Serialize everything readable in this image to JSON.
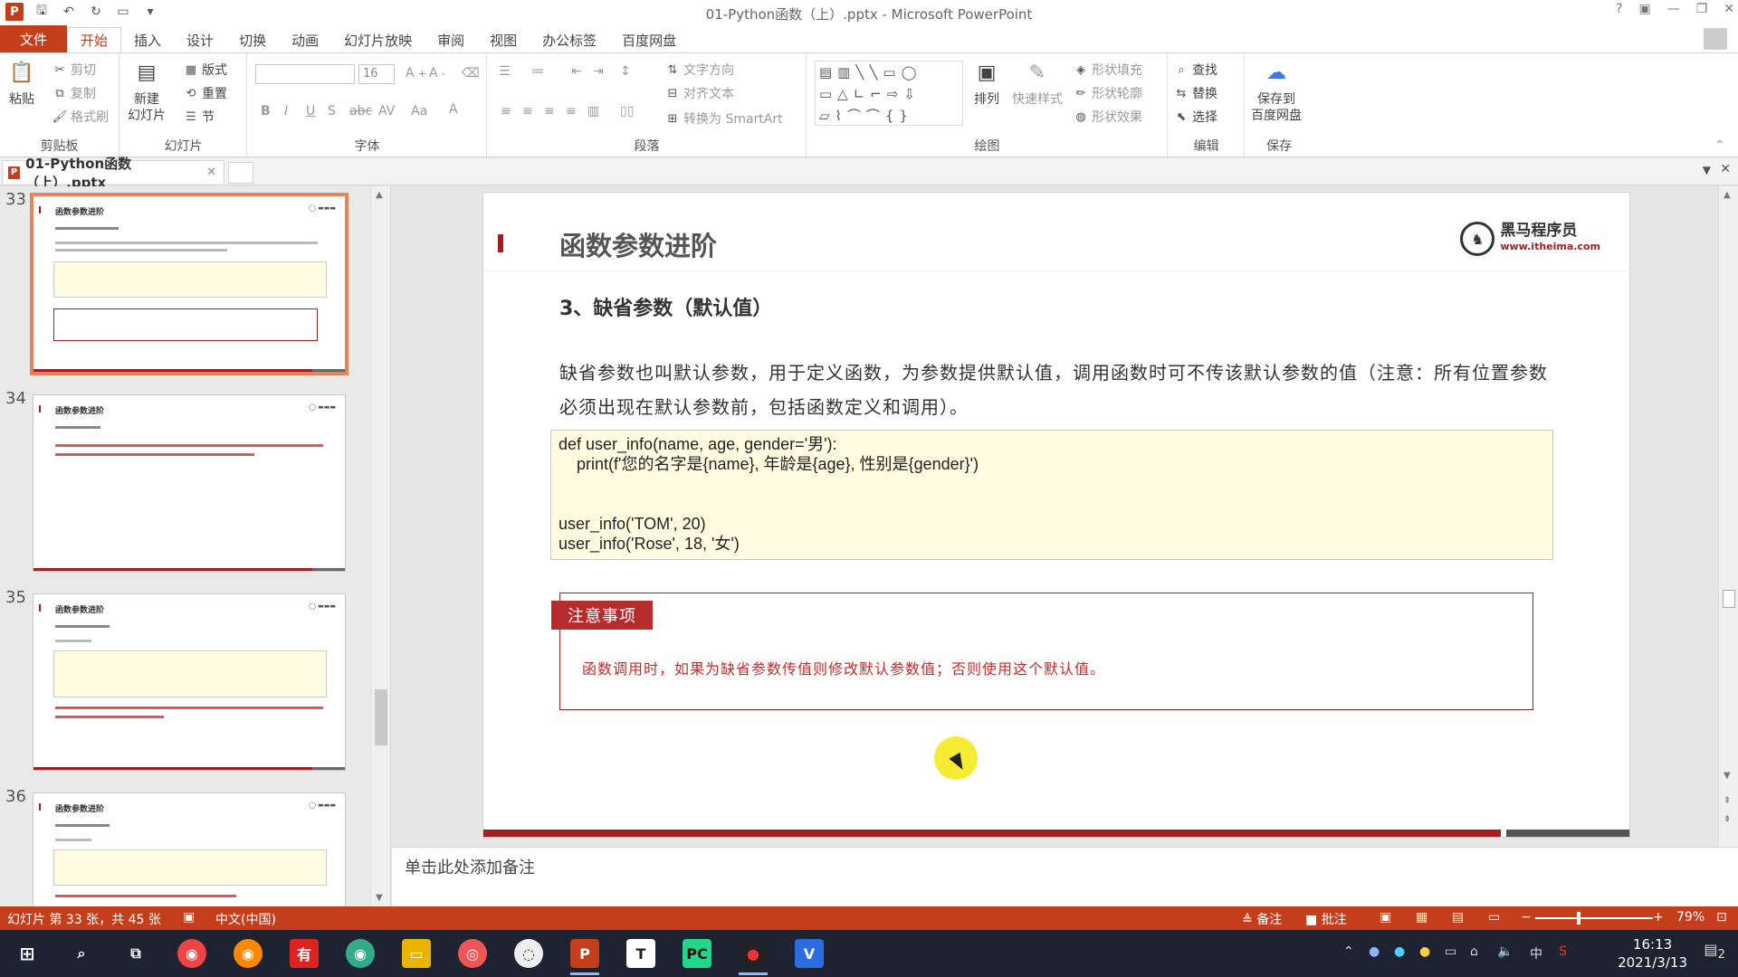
{
  "window": {
    "title": "01-Python函数（上）.pptx - Microsoft PowerPoint",
    "controls": [
      "?",
      "▣",
      "—",
      "❐",
      "✕"
    ]
  },
  "tabs": [
    "文件",
    "开始",
    "插入",
    "设计",
    "切换",
    "动画",
    "幻灯片放映",
    "审阅",
    "视图",
    "办公标签",
    "百度网盘"
  ],
  "ribbon": {
    "clipboard": {
      "label": "剪贴板",
      "paste": "粘贴",
      "cut": "剪切",
      "copy": "复制",
      "format_painter": "格式刷"
    },
    "slides": {
      "label": "幻灯片",
      "new_slide": "新建\n幻灯片",
      "layout": "版式",
      "reset": "重置",
      "section": "节"
    },
    "font": {
      "label": "字体",
      "font_size": "16"
    },
    "paragraph": {
      "label": "段落",
      "text_direction": "文字方向",
      "align_text": "对齐文本",
      "smartart": "转换为 SmartArt"
    },
    "drawing": {
      "label": "绘图",
      "arrange": "排列",
      "quick_styles": "快速样式",
      "shape_fill": "形状填充",
      "shape_outline": "形状轮廓",
      "shape_effects": "形状效果"
    },
    "editing": {
      "label": "编辑",
      "find": "查找",
      "replace": "替换",
      "select": "选择"
    },
    "save": {
      "label": "保存",
      "save_baidu": "保存到\n百度网盘"
    }
  },
  "doc_tab": {
    "name": "01-Python函数（上）.pptx"
  },
  "thumbnails": [
    {
      "num": "33",
      "title": "函数参数进阶"
    },
    {
      "num": "34",
      "title": "函数参数进阶"
    },
    {
      "num": "35",
      "title": "函数参数进阶"
    },
    {
      "num": "36",
      "title": "函数参数进阶"
    }
  ],
  "slide": {
    "title": "函数参数进阶",
    "logo_main": "黑马程序员",
    "logo_sub": "www.itheima.com",
    "subtitle": "3、缺省参数（默认值）",
    "paragraph": "缺省参数也叫默认参数，用于定义函数，为参数提供默认值，调用函数时可不传该默认参数的值（注意：所有位置参数必须出现在默认参数前，包括函数定义和调用）。",
    "code": [
      "def user_info(name, age, gender='男'):",
      "    print(f'您的名字是{name}, 年龄是{age}, 性别是{gender}')",
      "",
      "",
      "user_info('TOM', 20)",
      "user_info('Rose', 18, '女')"
    ],
    "note_tag": "注意事项",
    "note_text": "函数调用时，如果为缺省参数传值则修改默认参数值；否则使用这个默认值。"
  },
  "notes_placeholder": "单击此处添加备注",
  "status": {
    "slide_info": "幻灯片 第 33 张，共 45 张",
    "language": "中文(中国)",
    "notes": "备注",
    "comments": "批注",
    "zoom": "79%"
  },
  "taskbar": {
    "time": "16:13",
    "date": "2021/3/13",
    "ime": "中",
    "notification_count": "2"
  }
}
